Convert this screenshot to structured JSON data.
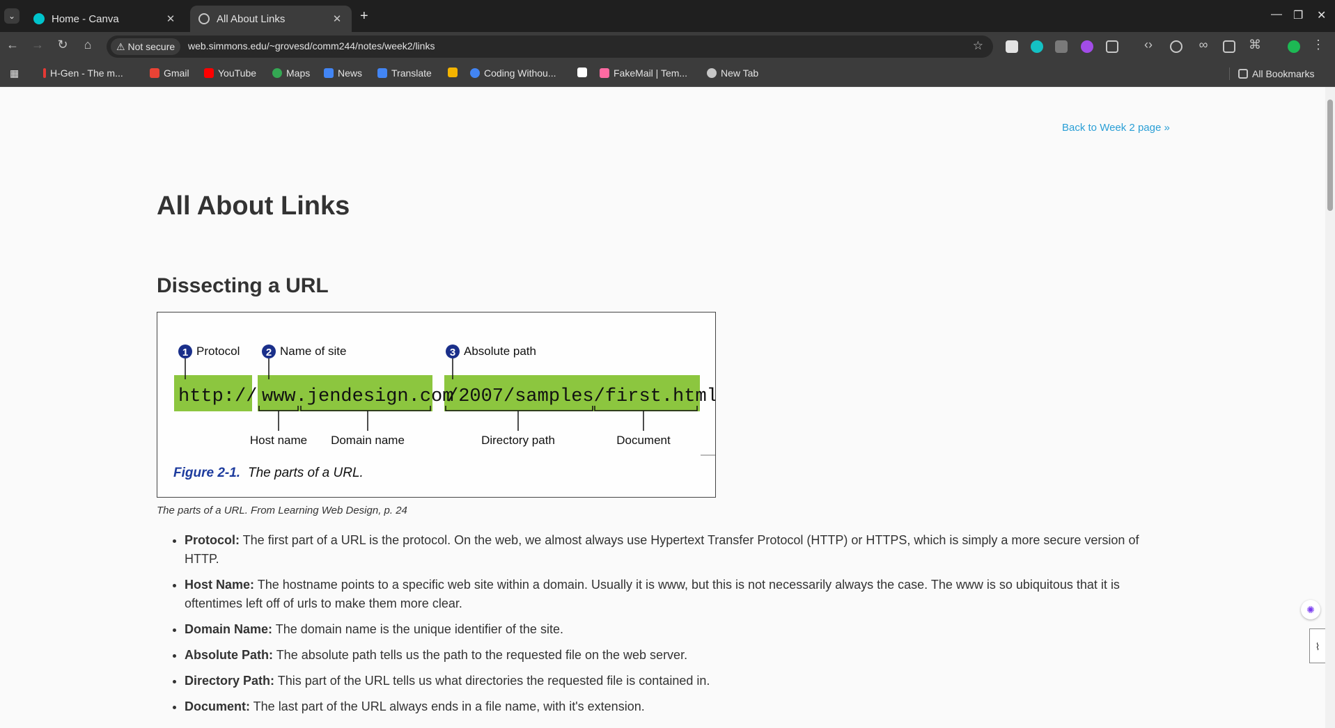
{
  "tabs": [
    {
      "title": "Home - Canva",
      "favicon": "canva-icon",
      "active": false
    },
    {
      "title": "All About Links",
      "favicon": "globe-icon",
      "active": true
    }
  ],
  "toolbar": {
    "security_label": "Not secure",
    "url": "web.simmons.edu/~grovesd/comm244/notes/week2/links"
  },
  "bookmarks": [
    {
      "label": "H-Gen - The m...",
      "icon": "h-gen-icon",
      "color": "#e53935"
    },
    {
      "label": "Gmail",
      "icon": "gmail-icon",
      "color": "#ea4335"
    },
    {
      "label": "YouTube",
      "icon": "youtube-icon",
      "color": "#ff0000"
    },
    {
      "label": "Maps",
      "icon": "maps-icon",
      "color": "#34a853"
    },
    {
      "label": "News",
      "icon": "news-icon",
      "color": "#4285f4"
    },
    {
      "label": "Translate",
      "icon": "translate-icon",
      "color": "#4285f4"
    },
    {
      "label": "",
      "icon": "extension-bookmark-icon",
      "color": "#f4b400"
    },
    {
      "label": "Coding Withou...",
      "icon": "coding-icon",
      "color": "#4285f4"
    },
    {
      "label": "",
      "icon": "doc-bookmark-icon",
      "color": "#ffffff"
    },
    {
      "label": "FakeMail | Tem...",
      "icon": "fakemail-icon",
      "color": "#ff6aa2"
    },
    {
      "label": "New Tab",
      "icon": "new-tab-icon",
      "color": "#c7c7c7"
    }
  ],
  "all_bookmarks_label": "All Bookmarks",
  "page": {
    "back_link": "Back to Week 2 page »",
    "title": "All About Links",
    "section_title": "Dissecting a URL",
    "figure": {
      "markers": [
        "1",
        "2",
        "3"
      ],
      "labels_top": [
        "Protocol",
        "Name of site",
        "Absolute path"
      ],
      "url_parts": [
        "http://",
        "www.jendesign.com",
        "/2007/samples/first.html"
      ],
      "labels_bottom": [
        "Host name",
        "Domain name",
        "Directory path",
        "Document"
      ],
      "fig_number": "Figure 2-1.",
      "fig_caption": "The parts of a URL."
    },
    "caption": "The parts of a URL. From Learning Web Design, p. 24",
    "definitions": [
      {
        "term": "Protocol:",
        "text": " The first part of a URL is the protocol. On the web, we almost always use Hypertext Transfer Protocol (HTTP) or HTTPS, which is simply a more secure version of HTTP."
      },
      {
        "term": "Host Name:",
        "text": " The hostname points to a specific web site within a domain. Usually it is www, but this is not necessarily always the case. The www is so ubiquitous that it is oftentimes left off of urls to make them more clear."
      },
      {
        "term": "Domain Name:",
        "text": " The domain name is the unique identifier of the site."
      },
      {
        "term": "Absolute Path:",
        "text": " The absolute path tells us the path to the requested file on the web server."
      },
      {
        "term": "Directory Path:",
        "text": " This part of the URL tells us what directories the requested file is contained in."
      },
      {
        "term": "Document:",
        "text": " The last part of the URL always ends in a file name, with it's extension."
      }
    ]
  }
}
